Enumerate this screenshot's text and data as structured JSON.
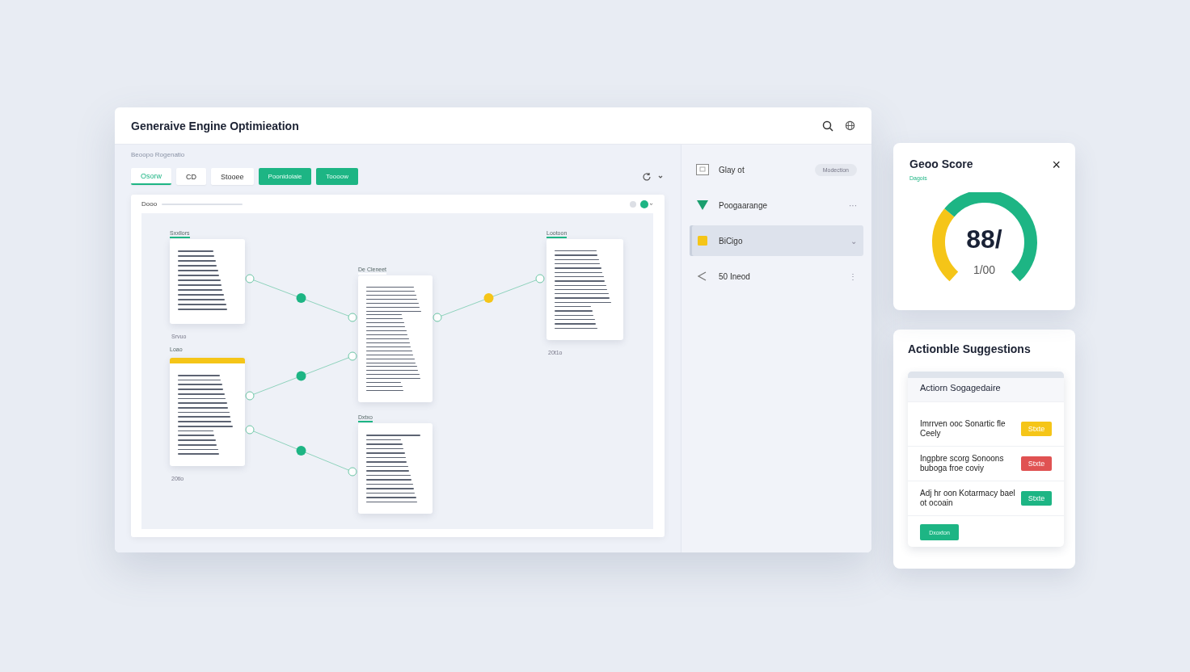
{
  "window": {
    "title": "Generaive Engine Optimieation"
  },
  "breadcrumb": "Beoopo Rogenatio",
  "toolbar": [
    {
      "kind": "tab",
      "label": "Osorw",
      "selected": true
    },
    {
      "kind": "tab",
      "label": "CD",
      "selected": false
    },
    {
      "kind": "tab",
      "label": "Stooee",
      "selected": false
    },
    {
      "kind": "primary",
      "label": "Poonidoiaie"
    },
    {
      "kind": "primary",
      "label": "Toooow"
    }
  ],
  "canvas": {
    "title": "Dooo",
    "toggle_on": true,
    "documents": [
      {
        "label": "Sxxllors",
        "caption": "Srvuo",
        "color": "#1db584"
      },
      {
        "label": "Loao",
        "caption": "20tlo",
        "color": "#f5c518"
      },
      {
        "label": "De Cleneet",
        "color": "#ffffff"
      },
      {
        "label": "Dxtxo",
        "color": "#1db584"
      },
      {
        "label": "Lootoon",
        "caption": "20t1o",
        "color": "#1db584"
      }
    ],
    "links": [
      {
        "color": "#1db584"
      },
      {
        "color": "#1db584"
      },
      {
        "color": "#1db584"
      },
      {
        "color": "#f5c518"
      }
    ]
  },
  "sidebar": {
    "items": [
      {
        "kind": "image",
        "label": "Glay ot",
        "badge": "Modection",
        "selected": false
      },
      {
        "kind": "triangle",
        "label": "Poogaarange",
        "trailing": "···",
        "selected": false
      },
      {
        "kind": "square",
        "label": "BiCigo",
        "trailing": "⌄",
        "selected": true
      },
      {
        "kind": "back",
        "label": "50 Ineod",
        "trailing": "⋮",
        "selected": false
      }
    ]
  },
  "score": {
    "title": "Geoo Score",
    "subtitle": "Dagois",
    "close": "×",
    "value": "88/",
    "max": "1/00"
  },
  "suggestions": {
    "title": "Actionble Suggestions",
    "header": "Actiorn Sogagedaire",
    "items": [
      {
        "text": "Imrrven ooc Sonartic fle Ceely",
        "action": "Stxte",
        "color": "#f5c518"
      },
      {
        "text": "Ingpbre scorg Sonoons buboga froe coviy",
        "action": "Stxte",
        "color": "#e05252"
      },
      {
        "text": "Adj hr oon Kotarmacy bael ot ocoain",
        "action": "Stxte",
        "color": "#1db584"
      }
    ],
    "button": "Dxoxton"
  }
}
